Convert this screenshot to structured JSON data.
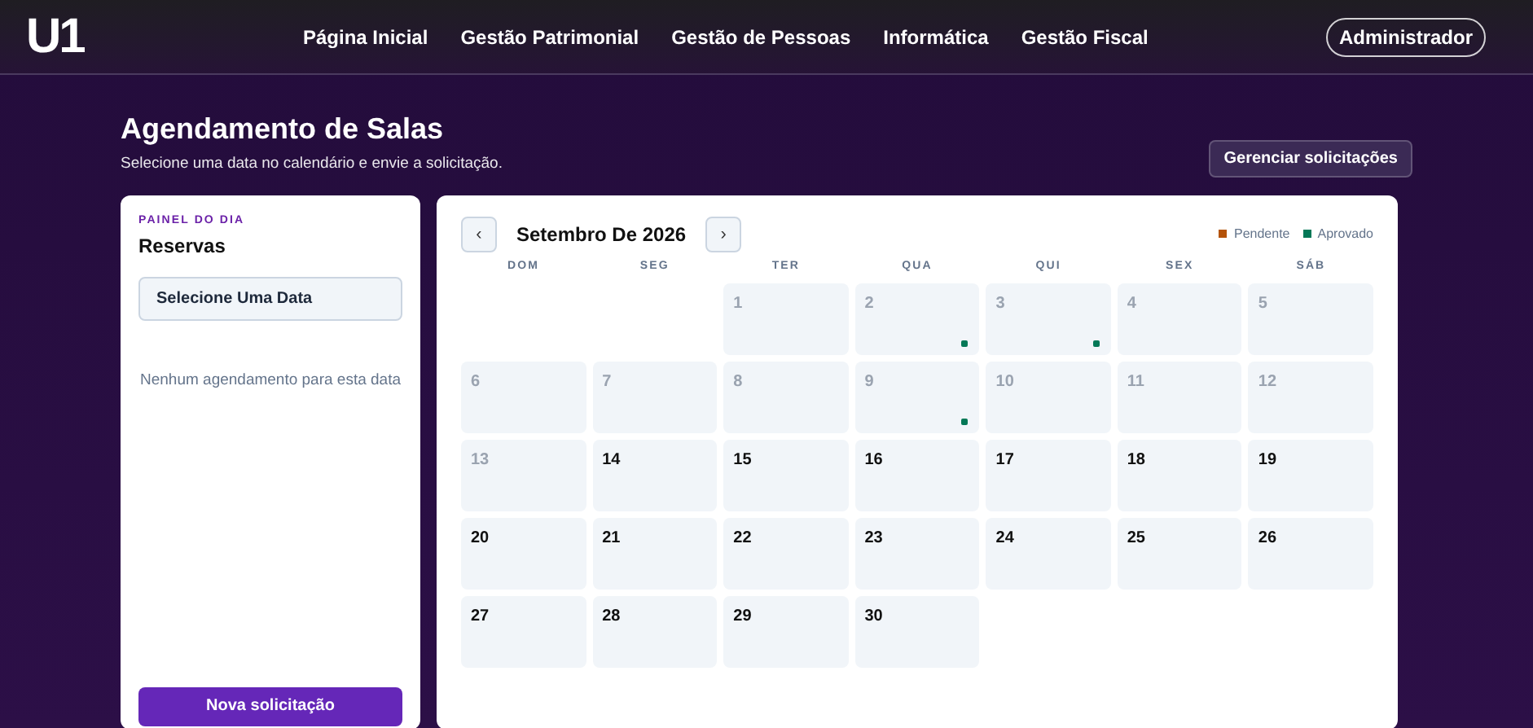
{
  "nav": {
    "logo": "U1",
    "links": [
      "Página Inicial",
      "Gestão Patrimonial",
      "Gestão de Pessoas",
      "Informática",
      "Gestão Fiscal"
    ],
    "user_button": "Administrador"
  },
  "page": {
    "title": "Agendamento de Salas",
    "subtitle": "Selecione uma data no calendário e envie a solicitação.",
    "manage_button": "Gerenciar solicitações"
  },
  "day_panel": {
    "eyebrow": "PAINEL DO DIA",
    "title": "Reservas",
    "date_field": "Selecione Uma Data",
    "empty_message": "Nenhum agendamento para esta data",
    "new_button": "Nova solicitação"
  },
  "calendar": {
    "prev": "‹",
    "next": "›",
    "month": "Setembro De 2026",
    "legend": [
      {
        "label": "Pendente",
        "color": "#b45309"
      },
      {
        "label": "Aprovado",
        "color": "#047857"
      }
    ],
    "weekdays": [
      "DOM",
      "SEG",
      "TER",
      "QUA",
      "QUI",
      "SEX",
      "SÁB"
    ],
    "days": [
      {
        "kind": "blank"
      },
      {
        "kind": "blank"
      },
      {
        "label": "1",
        "disabled": true
      },
      {
        "label": "2",
        "disabled": true,
        "color": "#047857"
      },
      {
        "label": "3",
        "disabled": true,
        "color": "#047857"
      },
      {
        "label": "4",
        "disabled": true
      },
      {
        "label": "5",
        "disabled": true
      },
      {
        "label": "6",
        "disabled": true
      },
      {
        "label": "7",
        "disabled": true
      },
      {
        "label": "8",
        "disabled": true
      },
      {
        "label": "9",
        "disabled": true,
        "color": "#047857"
      },
      {
        "label": "10",
        "disabled": true
      },
      {
        "label": "11",
        "disabled": true
      },
      {
        "label": "12",
        "disabled": true
      },
      {
        "label": "13",
        "disabled": true
      },
      {
        "label": "14",
        "disabled": false
      },
      {
        "label": "15",
        "disabled": false
      },
      {
        "label": "16",
        "disabled": false
      },
      {
        "label": "17",
        "disabled": false
      },
      {
        "label": "18",
        "disabled": false
      },
      {
        "label": "19",
        "disabled": false
      },
      {
        "label": "20",
        "disabled": false
      },
      {
        "label": "21",
        "disabled": false
      },
      {
        "label": "22",
        "disabled": false
      },
      {
        "label": "23",
        "disabled": false
      },
      {
        "label": "24",
        "disabled": false
      },
      {
        "label": "25",
        "disabled": false
      },
      {
        "label": "26",
        "disabled": false
      },
      {
        "label": "27",
        "disabled": false
      },
      {
        "label": "28",
        "disabled": false
      },
      {
        "label": "29",
        "disabled": false
      },
      {
        "label": "30",
        "disabled": false
      }
    ]
  }
}
